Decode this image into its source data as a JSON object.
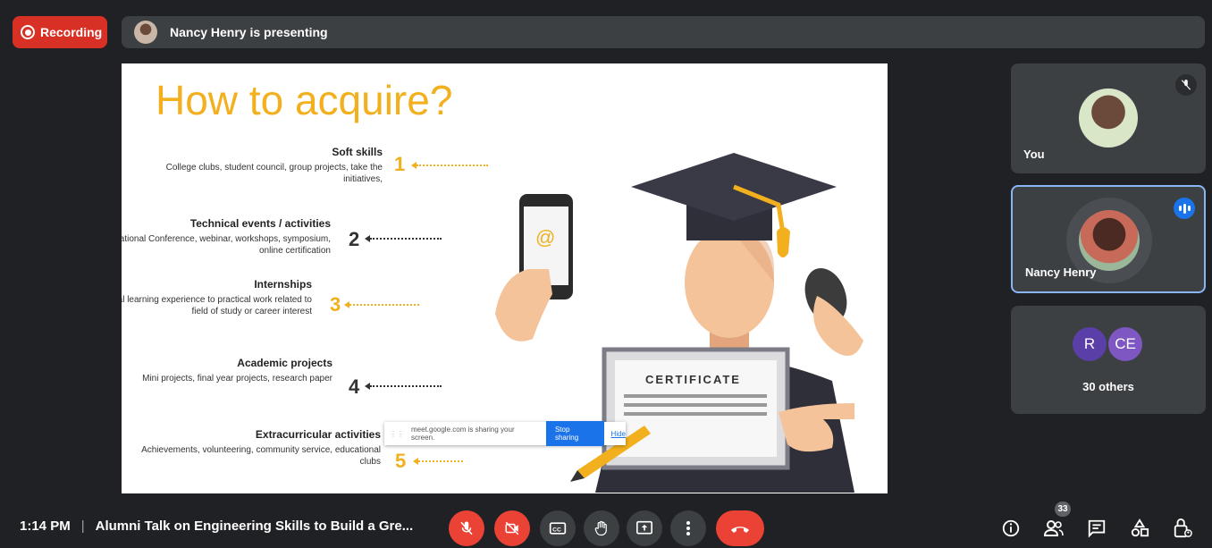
{
  "recording": {
    "label": "Recording"
  },
  "presenting": {
    "text": "Nancy Henry is presenting"
  },
  "slide": {
    "title": "How to acquire?",
    "items": [
      {
        "number": "1",
        "heading": "Soft skills",
        "desc": "College clubs, student council, group projects, take the initiatives,"
      },
      {
        "number": "2",
        "heading": "Technical events / activities",
        "desc": "International Conference, webinar, workshops, symposium, online certification"
      },
      {
        "number": "3",
        "heading": "Internships",
        "desc": "Professional learning experience to practical work related to field of study or career interest"
      },
      {
        "number": "4",
        "heading": "Academic projects",
        "desc": "Mini projects, final year projects, research paper"
      },
      {
        "number": "5",
        "heading": "Extracurricular activities",
        "desc": "Achievements, volunteering, community service, educational clubs"
      }
    ],
    "certificate_label": "CERTIFICATE",
    "phone_symbol": "@"
  },
  "share_bar": {
    "message": "meet.google.com is sharing your screen.",
    "stop_label": "Stop sharing",
    "hide_label": "Hide"
  },
  "participants": {
    "you": {
      "name": "You"
    },
    "nancy": {
      "name": "Nancy Henry"
    },
    "others": {
      "initials": [
        "R",
        "CE"
      ],
      "label": "30 others"
    }
  },
  "bottom": {
    "time": "1:14 PM",
    "separator": "|",
    "meeting_title": "Alumni Talk on Engineering Skills to Build a Gre...",
    "people_count": "33"
  },
  "colors": {
    "accent_red": "#ea4335",
    "accent_blue": "#1a73e8",
    "slide_yellow": "#f2b01e"
  }
}
